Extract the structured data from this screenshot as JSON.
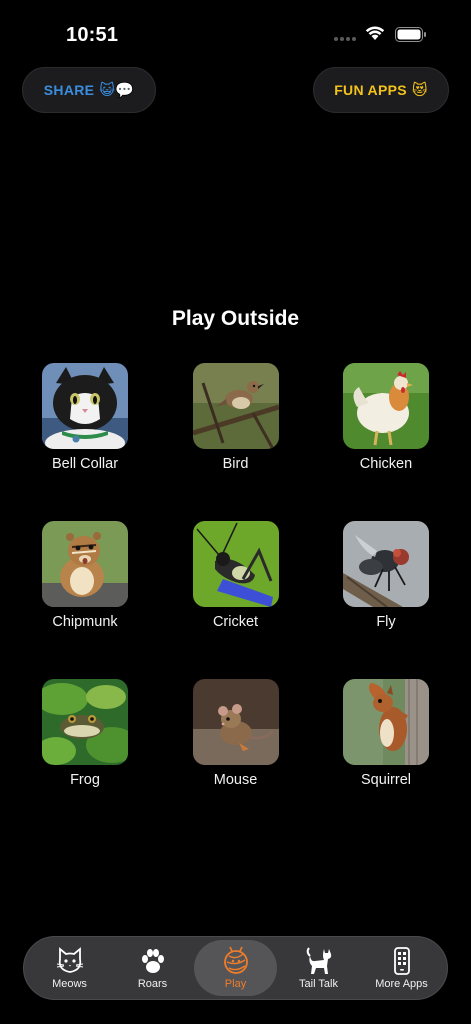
{
  "status": {
    "time": "10:51"
  },
  "header": {
    "share_label": "SHARE",
    "share_emoji": "😺💬",
    "fun_label": "FUN APPS",
    "fun_emoji": "😻"
  },
  "section": {
    "title": "Play Outside"
  },
  "tiles": [
    {
      "label": "Bell Collar"
    },
    {
      "label": "Bird"
    },
    {
      "label": "Chicken"
    },
    {
      "label": "Chipmunk"
    },
    {
      "label": "Cricket"
    },
    {
      "label": "Fly"
    },
    {
      "label": "Frog"
    },
    {
      "label": "Mouse"
    },
    {
      "label": "Squirrel"
    }
  ],
  "tabs": [
    {
      "label": "Meows"
    },
    {
      "label": "Roars"
    },
    {
      "label": "Play"
    },
    {
      "label": "Tail Talk"
    },
    {
      "label": "More Apps"
    }
  ],
  "colors": {
    "accent": "#f07d2a",
    "share": "#3a8dde",
    "fun": "#f2c21b"
  }
}
